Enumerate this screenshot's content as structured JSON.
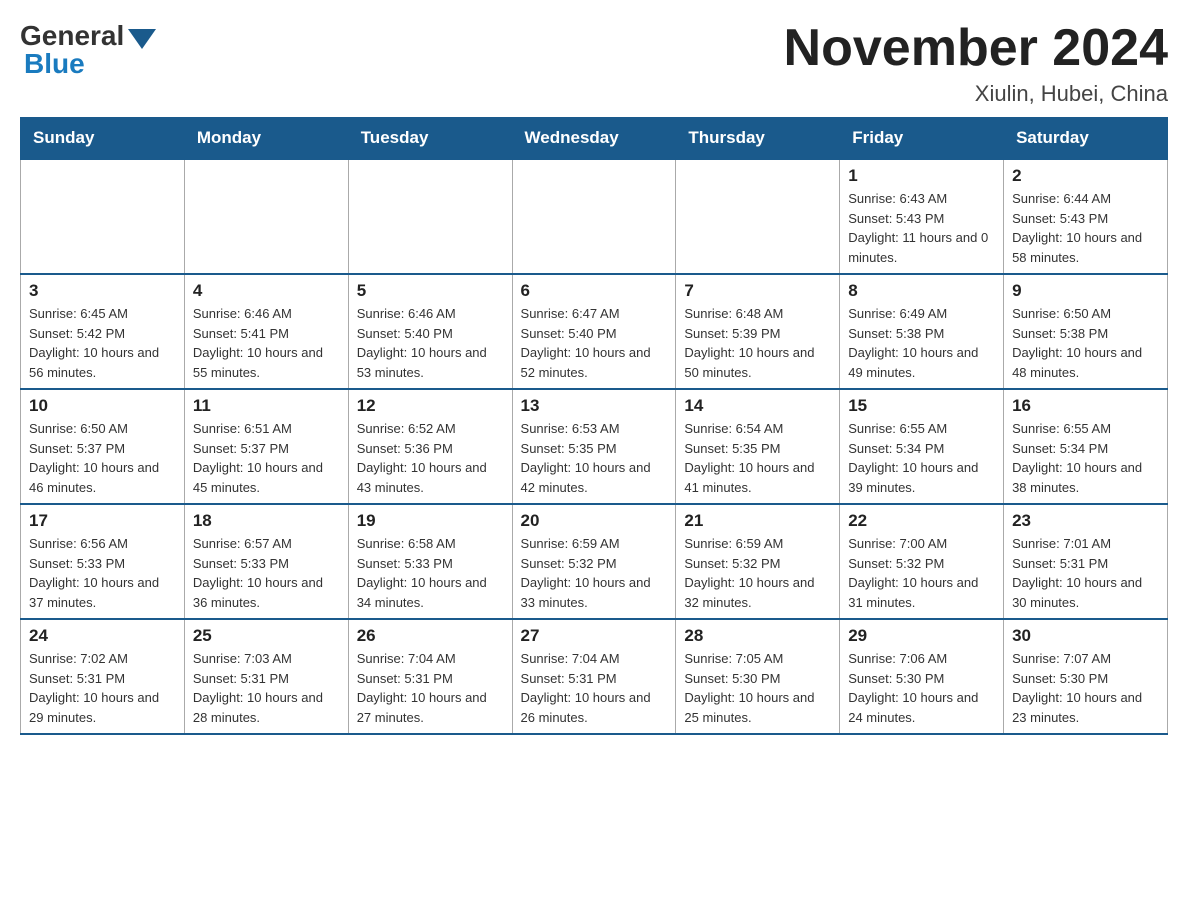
{
  "header": {
    "logo_general": "General",
    "logo_blue": "Blue",
    "main_title": "November 2024",
    "subtitle": "Xiulin, Hubei, China"
  },
  "weekdays": [
    "Sunday",
    "Monday",
    "Tuesday",
    "Wednesday",
    "Thursday",
    "Friday",
    "Saturday"
  ],
  "weeks": [
    [
      {
        "day": "",
        "info": ""
      },
      {
        "day": "",
        "info": ""
      },
      {
        "day": "",
        "info": ""
      },
      {
        "day": "",
        "info": ""
      },
      {
        "day": "",
        "info": ""
      },
      {
        "day": "1",
        "info": "Sunrise: 6:43 AM\nSunset: 5:43 PM\nDaylight: 11 hours and 0 minutes."
      },
      {
        "day": "2",
        "info": "Sunrise: 6:44 AM\nSunset: 5:43 PM\nDaylight: 10 hours and 58 minutes."
      }
    ],
    [
      {
        "day": "3",
        "info": "Sunrise: 6:45 AM\nSunset: 5:42 PM\nDaylight: 10 hours and 56 minutes."
      },
      {
        "day": "4",
        "info": "Sunrise: 6:46 AM\nSunset: 5:41 PM\nDaylight: 10 hours and 55 minutes."
      },
      {
        "day": "5",
        "info": "Sunrise: 6:46 AM\nSunset: 5:40 PM\nDaylight: 10 hours and 53 minutes."
      },
      {
        "day": "6",
        "info": "Sunrise: 6:47 AM\nSunset: 5:40 PM\nDaylight: 10 hours and 52 minutes."
      },
      {
        "day": "7",
        "info": "Sunrise: 6:48 AM\nSunset: 5:39 PM\nDaylight: 10 hours and 50 minutes."
      },
      {
        "day": "8",
        "info": "Sunrise: 6:49 AM\nSunset: 5:38 PM\nDaylight: 10 hours and 49 minutes."
      },
      {
        "day": "9",
        "info": "Sunrise: 6:50 AM\nSunset: 5:38 PM\nDaylight: 10 hours and 48 minutes."
      }
    ],
    [
      {
        "day": "10",
        "info": "Sunrise: 6:50 AM\nSunset: 5:37 PM\nDaylight: 10 hours and 46 minutes."
      },
      {
        "day": "11",
        "info": "Sunrise: 6:51 AM\nSunset: 5:37 PM\nDaylight: 10 hours and 45 minutes."
      },
      {
        "day": "12",
        "info": "Sunrise: 6:52 AM\nSunset: 5:36 PM\nDaylight: 10 hours and 43 minutes."
      },
      {
        "day": "13",
        "info": "Sunrise: 6:53 AM\nSunset: 5:35 PM\nDaylight: 10 hours and 42 minutes."
      },
      {
        "day": "14",
        "info": "Sunrise: 6:54 AM\nSunset: 5:35 PM\nDaylight: 10 hours and 41 minutes."
      },
      {
        "day": "15",
        "info": "Sunrise: 6:55 AM\nSunset: 5:34 PM\nDaylight: 10 hours and 39 minutes."
      },
      {
        "day": "16",
        "info": "Sunrise: 6:55 AM\nSunset: 5:34 PM\nDaylight: 10 hours and 38 minutes."
      }
    ],
    [
      {
        "day": "17",
        "info": "Sunrise: 6:56 AM\nSunset: 5:33 PM\nDaylight: 10 hours and 37 minutes."
      },
      {
        "day": "18",
        "info": "Sunrise: 6:57 AM\nSunset: 5:33 PM\nDaylight: 10 hours and 36 minutes."
      },
      {
        "day": "19",
        "info": "Sunrise: 6:58 AM\nSunset: 5:33 PM\nDaylight: 10 hours and 34 minutes."
      },
      {
        "day": "20",
        "info": "Sunrise: 6:59 AM\nSunset: 5:32 PM\nDaylight: 10 hours and 33 minutes."
      },
      {
        "day": "21",
        "info": "Sunrise: 6:59 AM\nSunset: 5:32 PM\nDaylight: 10 hours and 32 minutes."
      },
      {
        "day": "22",
        "info": "Sunrise: 7:00 AM\nSunset: 5:32 PM\nDaylight: 10 hours and 31 minutes."
      },
      {
        "day": "23",
        "info": "Sunrise: 7:01 AM\nSunset: 5:31 PM\nDaylight: 10 hours and 30 minutes."
      }
    ],
    [
      {
        "day": "24",
        "info": "Sunrise: 7:02 AM\nSunset: 5:31 PM\nDaylight: 10 hours and 29 minutes."
      },
      {
        "day": "25",
        "info": "Sunrise: 7:03 AM\nSunset: 5:31 PM\nDaylight: 10 hours and 28 minutes."
      },
      {
        "day": "26",
        "info": "Sunrise: 7:04 AM\nSunset: 5:31 PM\nDaylight: 10 hours and 27 minutes."
      },
      {
        "day": "27",
        "info": "Sunrise: 7:04 AM\nSunset: 5:31 PM\nDaylight: 10 hours and 26 minutes."
      },
      {
        "day": "28",
        "info": "Sunrise: 7:05 AM\nSunset: 5:30 PM\nDaylight: 10 hours and 25 minutes."
      },
      {
        "day": "29",
        "info": "Sunrise: 7:06 AM\nSunset: 5:30 PM\nDaylight: 10 hours and 24 minutes."
      },
      {
        "day": "30",
        "info": "Sunrise: 7:07 AM\nSunset: 5:30 PM\nDaylight: 10 hours and 23 minutes."
      }
    ]
  ]
}
